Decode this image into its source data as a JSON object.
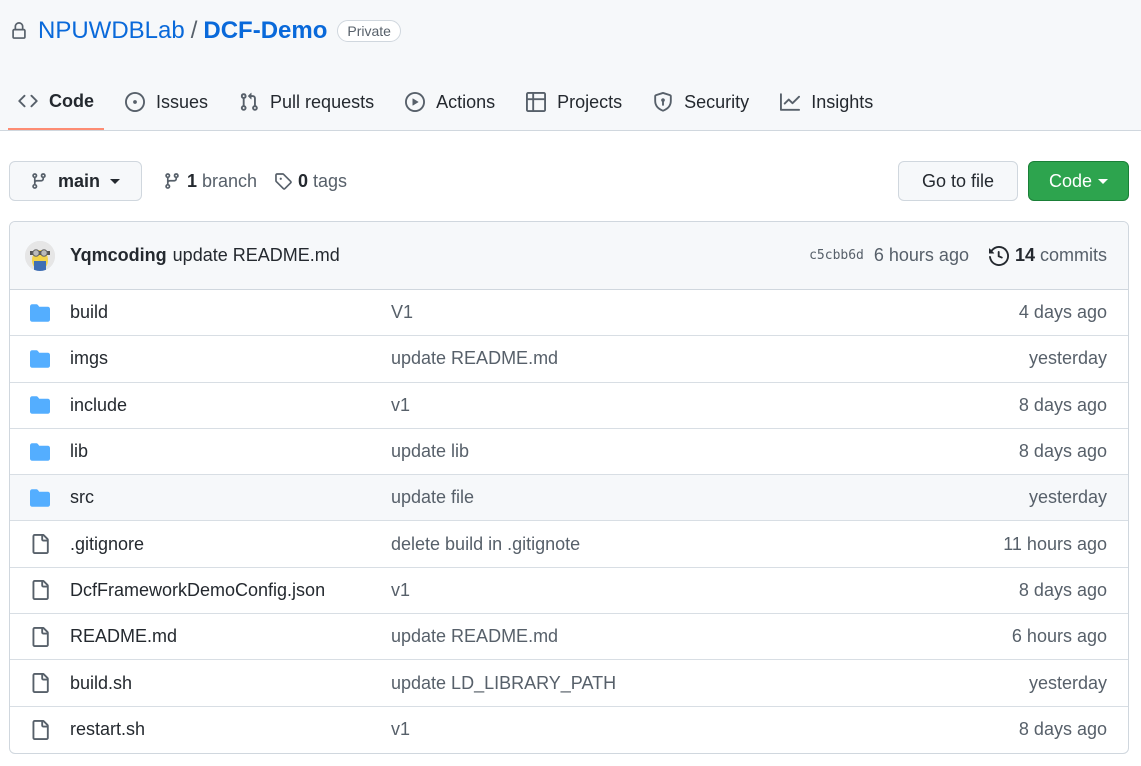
{
  "repo": {
    "owner": "NPUWDBLab",
    "separator": "/",
    "name": "DCF-Demo",
    "visibility": "Private"
  },
  "tabs": [
    {
      "label": "Code",
      "icon": "code-icon",
      "active": true
    },
    {
      "label": "Issues",
      "icon": "issue-icon"
    },
    {
      "label": "Pull requests",
      "icon": "pull-request-icon"
    },
    {
      "label": "Actions",
      "icon": "play-icon"
    },
    {
      "label": "Projects",
      "icon": "table-icon"
    },
    {
      "label": "Security",
      "icon": "shield-icon"
    },
    {
      "label": "Insights",
      "icon": "graph-icon"
    }
  ],
  "toolbar": {
    "branch": "main",
    "branch_count": "1",
    "branch_label": "branch",
    "tag_count": "0",
    "tag_label": "tags",
    "goto_label": "Go to file",
    "code_label": "Code"
  },
  "commit": {
    "author": "Yqmcoding",
    "message": "update README.md",
    "sha": "c5cbb6d",
    "time": "6 hours ago",
    "count": "14",
    "count_label": "commits"
  },
  "files": [
    {
      "type": "folder",
      "name": "build",
      "message": "V1",
      "age": "4 days ago"
    },
    {
      "type": "folder",
      "name": "imgs",
      "message": "update README.md",
      "age": "yesterday"
    },
    {
      "type": "folder",
      "name": "include",
      "message": "v1",
      "age": "8 days ago"
    },
    {
      "type": "folder",
      "name": "lib",
      "message": "update lib",
      "age": "8 days ago"
    },
    {
      "type": "folder",
      "name": "src",
      "message": "update file",
      "age": "yesterday"
    },
    {
      "type": "file",
      "name": ".gitignore",
      "message": "delete build in .gitignote",
      "age": "11 hours ago"
    },
    {
      "type": "file",
      "name": "DcfFrameworkDemoConfig.json",
      "message": "v1",
      "age": "8 days ago"
    },
    {
      "type": "file",
      "name": "README.md",
      "message": "update README.md",
      "age": "6 hours ago"
    },
    {
      "type": "file",
      "name": "build.sh",
      "message": "update LD_LIBRARY_PATH",
      "age": "yesterday"
    },
    {
      "type": "file",
      "name": "restart.sh",
      "message": "v1",
      "age": "8 days ago"
    }
  ],
  "colors": {
    "link": "#0969da",
    "folder": "#54aeff",
    "primary_button": "#2da44e",
    "active_tab_underline": "#fd8c73"
  }
}
